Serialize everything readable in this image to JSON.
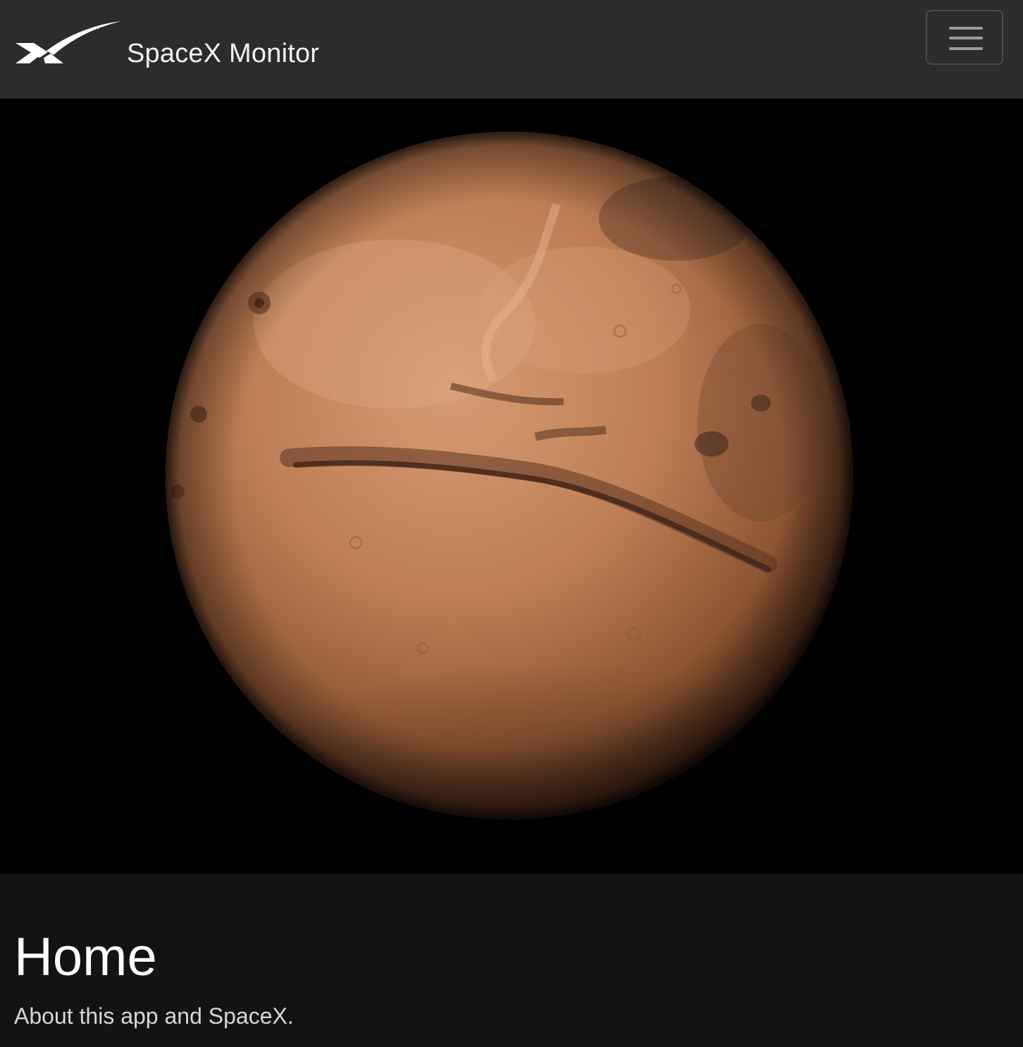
{
  "navbar": {
    "logo_icon": "spacex-x-logo-icon",
    "title": "SpaceX Monitor",
    "menu_icon": "hamburger-menu-icon",
    "background": "#2b2c2e"
  },
  "hero": {
    "image_subject": "mars-planet-image",
    "background": "#000000"
  },
  "main": {
    "title": "Home",
    "subtitle": "About this app and SpaceX."
  },
  "colors": {
    "page_background": "#131313",
    "title_text": "#ffffff",
    "subtitle_text": "#d7d7d7",
    "mars_base": "#b5724a"
  }
}
